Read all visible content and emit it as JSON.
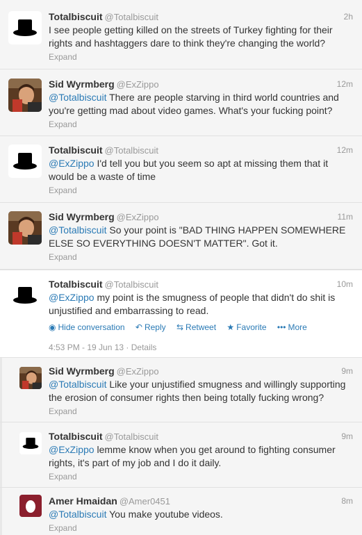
{
  "tweets": [
    {
      "name": "Totalbiscuit",
      "handle": "@Totalbiscuit",
      "time": "2h",
      "text": "I see people getting killed on the streets of Turkey fighting for their rights and hashtaggers dare to think they're changing the world?",
      "expand": "Expand",
      "avatar": "top-hat"
    },
    {
      "name": "Sid Wyrmberg",
      "handle": "@ExZippo",
      "time": "12m",
      "mention": "@Totalbiscuit",
      "text": " There are people starving in third world countries and you're getting mad about video games. What's your fucking point?",
      "expand": "Expand",
      "avatar": "photo"
    },
    {
      "name": "Totalbiscuit",
      "handle": "@Totalbiscuit",
      "time": "12m",
      "mention": "@ExZippo",
      "text": " I'd tell you but you seem so apt at missing them that it would be a waste of time",
      "expand": "Expand",
      "avatar": "top-hat"
    },
    {
      "name": "Sid Wyrmberg",
      "handle": "@ExZippo",
      "time": "11m",
      "mention": "@Totalbiscuit",
      "text": " So your point is \"BAD THING HAPPEN SOMEWHERE ELSE SO EVERYTHING DOESN'T MATTER\". Got it.",
      "expand": "Expand",
      "avatar": "photo"
    },
    {
      "name": "Totalbiscuit",
      "handle": "@Totalbiscuit",
      "time": "10m",
      "mention": "@ExZippo",
      "text": " my point is the smugness of people that didn't do shit is unjustified and embarrassing to read.",
      "avatar": "top-hat",
      "actions": {
        "hide": "Hide conversation",
        "reply": "Reply",
        "retweet": "Retweet",
        "favorite": "Favorite",
        "more": "More"
      },
      "meta": "4:53 PM - 19 Jun 13 · Details"
    },
    {
      "name": "Sid Wyrmberg",
      "handle": "@ExZippo",
      "time": "9m",
      "mention": "@Totalbiscuit",
      "text": " Like your unjustified smugness and willingly supporting the erosion of consumer rights then being totally fucking wrong?",
      "expand": "Expand",
      "avatar": "photo"
    },
    {
      "name": "Totalbiscuit",
      "handle": "@Totalbiscuit",
      "time": "9m",
      "mention": "@ExZippo",
      "text": " lemme know when you get around to fighting consumer rights, it's part of my job and I do it daily.",
      "expand": "Expand",
      "avatar": "top-hat"
    },
    {
      "name": "Amer Hmaidan",
      "handle": "@Amer0451",
      "time": "8m",
      "mention": "@Totalbiscuit",
      "text": " You make youtube videos.",
      "expand": "Expand",
      "avatar": "egg"
    }
  ],
  "colors": {
    "link": "#2a7ab5",
    "muted": "#999999",
    "text": "#333333",
    "egg_bg": "#8b1f2d"
  }
}
